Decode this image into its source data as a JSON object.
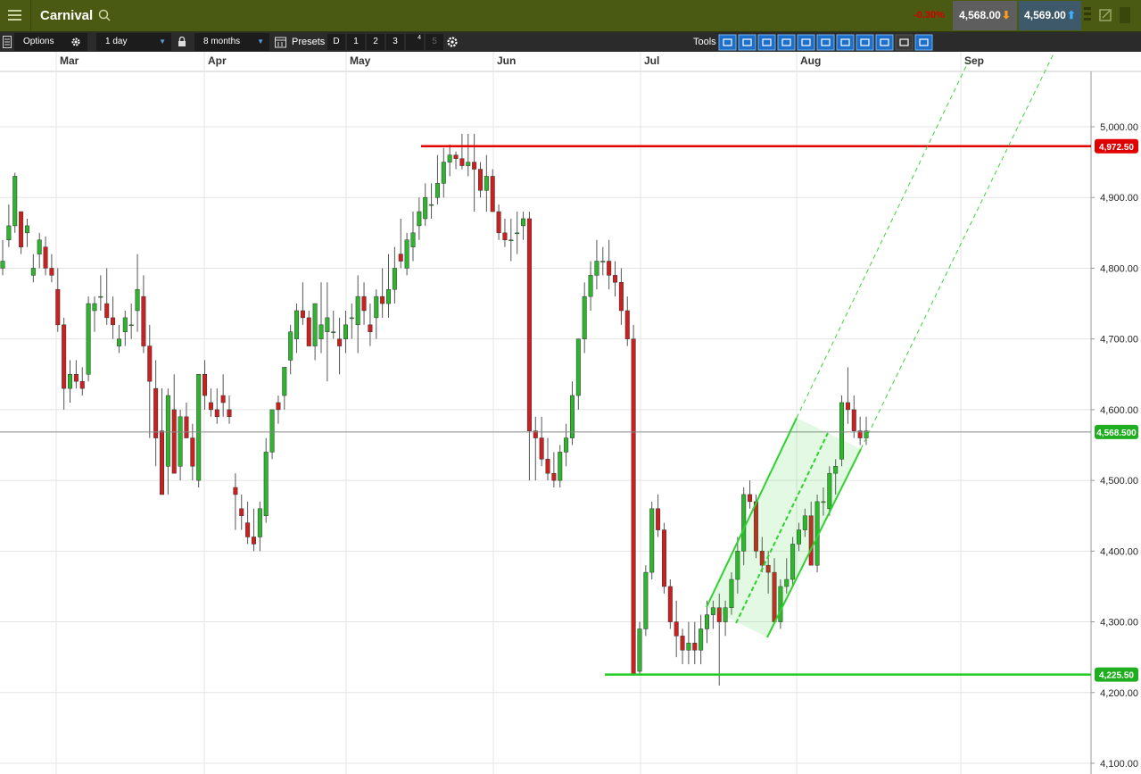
{
  "app": {
    "instrument": "Carnival",
    "change": "-0.30%",
    "sell_price": "4,568.00",
    "buy_price": "4,569.00"
  },
  "toolbar": {
    "options_label": "Options",
    "interval": "1 day",
    "range": "8 months",
    "presets_label": "Presets",
    "preset_buttons": [
      "D",
      "1",
      "2",
      "3",
      "4",
      "5"
    ],
    "tools_label": "Tools"
  },
  "colors": {
    "header_bg": "#4b5a12",
    "toolbar_bg": "#2b2b2b",
    "up_candle": "#2db52d",
    "down_candle": "#cc1f1f",
    "resistance": "#e00000",
    "support": "#22cc22",
    "tool_active": "#1e6fc9"
  },
  "chart_data": {
    "type": "candlestick",
    "months": [
      "Mar",
      "Apr",
      "May",
      "Jun",
      "Jul",
      "Aug",
      "Sep"
    ],
    "y_ticks": [
      "5,000.00",
      "4,900.00",
      "4,800.00",
      "4,700.00",
      "4,600.00",
      "4,500.00",
      "4,400.00",
      "4,300.00",
      "4,200.00",
      "4,100.00"
    ],
    "ylim": [
      4100,
      5000
    ],
    "grid": true,
    "current_price": 4568.5,
    "current_price_label": "4,568.500",
    "resistance": {
      "value": 4972.5,
      "label": "4,972.50"
    },
    "support": {
      "value": 4225.5,
      "label": "4,225.50"
    },
    "candles": [
      [
        4800,
        4840,
        4790,
        4810
      ],
      [
        4840,
        4890,
        4830,
        4860
      ],
      [
        4860,
        4935,
        4850,
        4930
      ],
      [
        4880,
        4870,
        4820,
        4830
      ],
      [
        4850,
        4870,
        4830,
        4860
      ],
      [
        4790,
        4820,
        4780,
        4800
      ],
      [
        4820,
        4850,
        4800,
        4840
      ],
      [
        4830,
        4845,
        4790,
        4800
      ],
      [
        4800,
        4820,
        4780,
        4790
      ],
      [
        4770,
        4800,
        4710,
        4720
      ],
      [
        4720,
        4730,
        4600,
        4630
      ],
      [
        4630,
        4670,
        4610,
        4650
      ],
      [
        4650,
        4670,
        4630,
        4640
      ],
      [
        4640,
        4660,
        4620,
        4630
      ],
      [
        4650,
        4760,
        4640,
        4750
      ],
      [
        4740,
        4760,
        4710,
        4750
      ],
      [
        4760,
        4790,
        4740,
        4760
      ],
      [
        4750,
        4800,
        4720,
        4730
      ],
      [
        4730,
        4760,
        4700,
        4720
      ],
      [
        4690,
        4720,
        4680,
        4700
      ],
      [
        4710,
        4740,
        4690,
        4730
      ],
      [
        4720,
        4750,
        4700,
        4720
      ],
      [
        4740,
        4820,
        4710,
        4770
      ],
      [
        4760,
        4790,
        4680,
        4690
      ],
      [
        4690,
        4720,
        4560,
        4640
      ],
      [
        4630,
        4670,
        4520,
        4560
      ],
      [
        4570,
        4630,
        4480,
        4480
      ],
      [
        4520,
        4630,
        4480,
        4620
      ],
      [
        4600,
        4650,
        4530,
        4510
      ],
      [
        4520,
        4600,
        4500,
        4590
      ],
      [
        4590,
        4610,
        4570,
        4560
      ],
      [
        4560,
        4580,
        4500,
        4520
      ],
      [
        4500,
        4620,
        4490,
        4650
      ],
      [
        4650,
        4670,
        4600,
        4620
      ],
      [
        4610,
        4630,
        4590,
        4600
      ],
      [
        4600,
        4630,
        4580,
        4590
      ],
      [
        4620,
        4650,
        4590,
        4610
      ],
      [
        4600,
        4620,
        4580,
        4590
      ],
      [
        4490,
        4510,
        4430,
        4480
      ],
      [
        4460,
        4480,
        4430,
        4450
      ],
      [
        4440,
        4470,
        4410,
        4420
      ],
      [
        4420,
        4460,
        4400,
        4410
      ],
      [
        4420,
        4470,
        4400,
        4460
      ],
      [
        4450,
        4560,
        4440,
        4540
      ],
      [
        4540,
        4600,
        4530,
        4600
      ],
      [
        4610,
        4620,
        4580,
        4600
      ],
      [
        4620,
        4660,
        4600,
        4660
      ],
      [
        4670,
        4720,
        4650,
        4710
      ],
      [
        4700,
        4750,
        4680,
        4740
      ],
      [
        4740,
        4780,
        4720,
        4730
      ],
      [
        4730,
        4740,
        4690,
        4690
      ],
      [
        4690,
        4750,
        4670,
        4750
      ],
      [
        4700,
        4780,
        4680,
        4720
      ],
      [
        4710,
        4780,
        4640,
        4730
      ],
      [
        4710,
        4740,
        4700,
        4710
      ],
      [
        4700,
        4730,
        4650,
        4690
      ],
      [
        4700,
        4740,
        4680,
        4720
      ],
      [
        4730,
        4750,
        4700,
        4730
      ],
      [
        4720,
        4790,
        4680,
        4760
      ],
      [
        4760,
        4780,
        4720,
        4740
      ],
      [
        4720,
        4750,
        4690,
        4710
      ],
      [
        4730,
        4770,
        4700,
        4760
      ],
      [
        4760,
        4800,
        4730,
        4750
      ],
      [
        4750,
        4820,
        4730,
        4770
      ],
      [
        4770,
        4830,
        4750,
        4800
      ],
      [
        4820,
        4870,
        4800,
        4810
      ],
      [
        4800,
        4850,
        4790,
        4840
      ],
      [
        4830,
        4880,
        4810,
        4850
      ],
      [
        4860,
        4900,
        4840,
        4880
      ],
      [
        4870,
        4920,
        4860,
        4900
      ],
      [
        4890,
        4920,
        4870,
        4890
      ],
      [
        4900,
        4960,
        4890,
        4920
      ],
      [
        4920,
        4970,
        4900,
        4950
      ],
      [
        4950,
        4975,
        4930,
        4960
      ],
      [
        4960,
        4965,
        4940,
        4955
      ],
      [
        4955,
        4990,
        4940,
        4945
      ],
      [
        4945,
        4990,
        4930,
        4950
      ],
      [
        4950,
        4990,
        4880,
        4940
      ],
      [
        4940,
        4950,
        4900,
        4910
      ],
      [
        4910,
        4960,
        4880,
        4930
      ],
      [
        4930,
        4940,
        4880,
        4880
      ],
      [
        4880,
        4890,
        4840,
        4850
      ],
      [
        4850,
        4870,
        4830,
        4840
      ],
      [
        4840,
        4870,
        4810,
        4840
      ],
      [
        4850,
        4880,
        4820,
        4850
      ],
      [
        4860,
        4880,
        4840,
        4870
      ],
      [
        4870,
        4880,
        4500,
        4570
      ],
      [
        4570,
        4590,
        4500,
        4560
      ],
      [
        4560,
        4590,
        4520,
        4530
      ],
      [
        4530,
        4560,
        4500,
        4510
      ],
      [
        4510,
        4540,
        4490,
        4500
      ],
      [
        4500,
        4550,
        4490,
        4540
      ],
      [
        4540,
        4580,
        4520,
        4560
      ],
      [
        4560,
        4640,
        4550,
        4620
      ],
      [
        4620,
        4700,
        4600,
        4700
      ],
      [
        4700,
        4780,
        4680,
        4760
      ],
      [
        4760,
        4810,
        4740,
        4790
      ],
      [
        4790,
        4840,
        4770,
        4810
      ],
      [
        4810,
        4830,
        4790,
        4810
      ],
      [
        4810,
        4840,
        4770,
        4790
      ],
      [
        4790,
        4810,
        4760,
        4780
      ],
      [
        4780,
        4800,
        4720,
        4740
      ],
      [
        4740,
        4760,
        4690,
        4700
      ],
      [
        4700,
        4720,
        4230,
        4225
      ],
      [
        4230,
        4300,
        4225,
        4290
      ],
      [
        4290,
        4380,
        4280,
        4370
      ],
      [
        4370,
        4470,
        4360,
        4460
      ],
      [
        4460,
        4480,
        4420,
        4430
      ],
      [
        4430,
        4440,
        4340,
        4350
      ],
      [
        4350,
        4360,
        4290,
        4300
      ],
      [
        4300,
        4330,
        4250,
        4280
      ],
      [
        4280,
        4290,
        4240,
        4260
      ],
      [
        4260,
        4300,
        4240,
        4270
      ],
      [
        4270,
        4300,
        4240,
        4260
      ],
      [
        4260,
        4310,
        4240,
        4290
      ],
      [
        4290,
        4330,
        4270,
        4310
      ],
      [
        4310,
        4330,
        4290,
        4320
      ],
      [
        4320,
        4340,
        4210,
        4300
      ],
      [
        4300,
        4330,
        4280,
        4320
      ],
      [
        4320,
        4370,
        4310,
        4360
      ],
      [
        4360,
        4420,
        4340,
        4400
      ],
      [
        4400,
        4490,
        4380,
        4480
      ],
      [
        4480,
        4500,
        4460,
        4470
      ],
      [
        4470,
        4480,
        4390,
        4400
      ],
      [
        4400,
        4420,
        4370,
        4380
      ],
      [
        4380,
        4400,
        4340,
        4370
      ],
      [
        4370,
        4390,
        4320,
        4300
      ],
      [
        4300,
        4360,
        4290,
        4350
      ],
      [
        4350,
        4390,
        4340,
        4360
      ],
      [
        4360,
        4420,
        4350,
        4410
      ],
      [
        4410,
        4440,
        4400,
        4430
      ],
      [
        4430,
        4460,
        4420,
        4450
      ],
      [
        4450,
        4470,
        4400,
        4380
      ],
      [
        4380,
        4480,
        4370,
        4470
      ],
      [
        4470,
        4490,
        4450,
        4470
      ],
      [
        4460,
        4520,
        4450,
        4510
      ],
      [
        4510,
        4530,
        4480,
        4520
      ],
      [
        4530,
        4620,
        4520,
        4610
      ],
      [
        4610,
        4660,
        4580,
        4600
      ],
      [
        4600,
        4620,
        4560,
        4570
      ],
      [
        4570,
        4590,
        4550,
        4560
      ],
      [
        4560,
        4590,
        4550,
        4570
      ]
    ]
  }
}
